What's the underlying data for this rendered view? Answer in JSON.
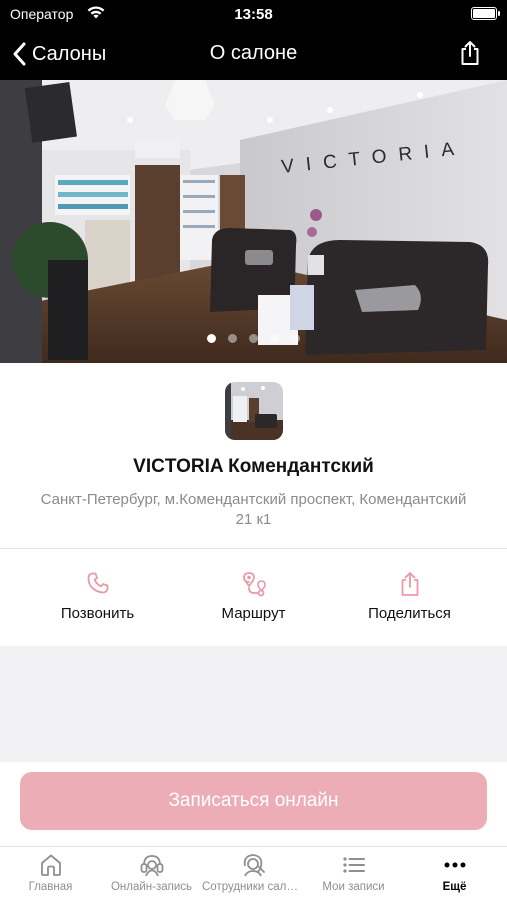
{
  "status_bar": {
    "carrier": "Оператор",
    "time": "13:58"
  },
  "nav": {
    "back_label": "Салоны",
    "title": "О салоне"
  },
  "hero": {
    "slides_count": 5,
    "active_slide": 1,
    "sign_text": "VICTORIA"
  },
  "salon": {
    "name": "VICTORIA Комендантский",
    "address": "Санкт-Петербург, м.Комендантский проспект, Комендантский 21 к1"
  },
  "actions": [
    {
      "label": "Позвонить",
      "icon": "phone-icon"
    },
    {
      "label": "Маршрут",
      "icon": "route-icon"
    },
    {
      "label": "Поделиться",
      "icon": "share-icon"
    }
  ],
  "booking": {
    "button_label": "Записаться онлайн"
  },
  "tabbar": [
    {
      "label": "Главная",
      "icon": "home-icon"
    },
    {
      "label": "Онлайн-запись",
      "icon": "online-booking-icon"
    },
    {
      "label": "Сотрудники салона",
      "icon": "staff-icon"
    },
    {
      "label": "Мои записи",
      "icon": "list-icon"
    },
    {
      "label": "Ещё",
      "icon": "more-icon",
      "active": true
    }
  ],
  "colors": {
    "accent": "#ecadb6",
    "icon_pink": "#e89aa7",
    "header_bg": "#000000"
  }
}
